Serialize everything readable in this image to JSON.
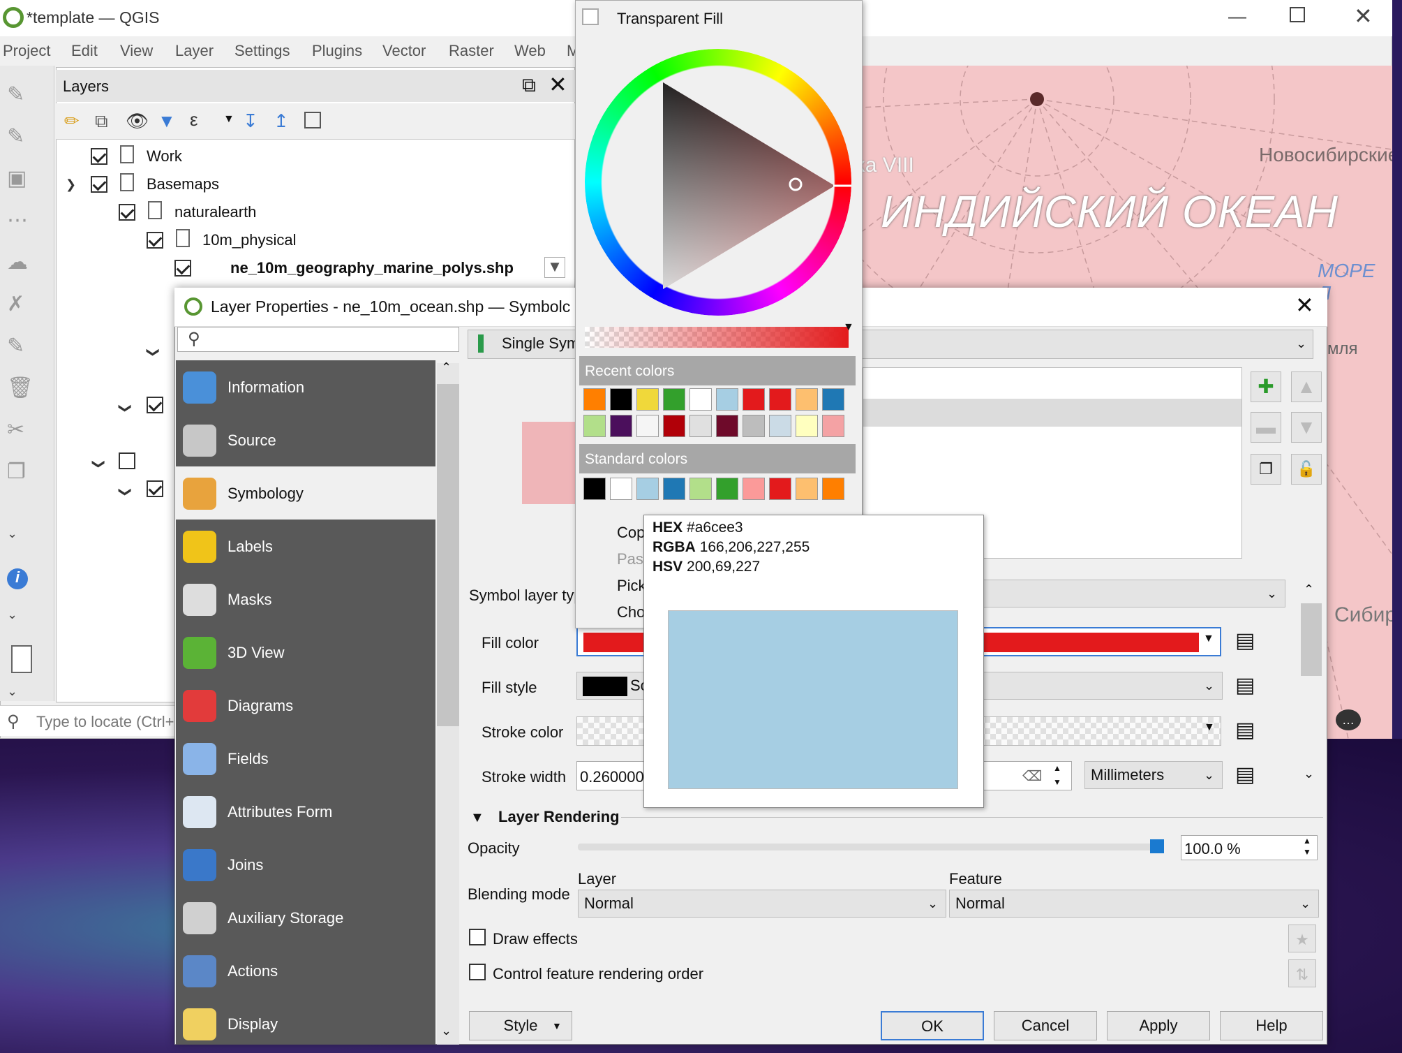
{
  "app": {
    "title": "*template — QGIS",
    "menu": [
      "Project",
      "Edit",
      "View",
      "Layer",
      "Settings",
      "Plugins",
      "Vector",
      "Raster",
      "Web",
      "M"
    ]
  },
  "layers_panel": {
    "title": "Layers",
    "tree": [
      {
        "label": "Work",
        "checked": true
      },
      {
        "label": "Basemaps",
        "checked": true
      },
      {
        "label": "naturalearth",
        "checked": true
      },
      {
        "label": "10m_physical",
        "checked": true
      },
      {
        "label": "ne_10m_geography_marine_polys.shp",
        "checked": true
      }
    ],
    "locator_placeholder": "Type to locate (Ctrl+"
  },
  "map_labels": {
    "ocean": "ИНДИЙСКИЙ ОКЕАН",
    "top_left": "ка VIII",
    "top_right": "Новосибирские",
    "sea": "МОРЕ Л",
    "mid_right": "мля",
    "bottom_right": "Сибир"
  },
  "dialog": {
    "title": "Layer Properties - ne_10m_ocean.shp — Symbolc",
    "renderer": "Single Sym",
    "sidebar": [
      {
        "label": "Information",
        "icon": "information-icon",
        "color": "#4a90d9"
      },
      {
        "label": "Source",
        "icon": "source-icon",
        "color": "#c7c7c7"
      },
      {
        "label": "Symbology",
        "icon": "symbology-icon",
        "color": "#e8a33d"
      },
      {
        "label": "Labels",
        "icon": "labels-icon",
        "color": "#f0c419"
      },
      {
        "label": "Masks",
        "icon": "masks-icon",
        "color": "#dddddd"
      },
      {
        "label": "3D View",
        "icon": "3d-view-icon",
        "color": "#5bb336"
      },
      {
        "label": "Diagrams",
        "icon": "diagrams-icon",
        "color": "#e23b3b"
      },
      {
        "label": "Fields",
        "icon": "fields-icon",
        "color": "#8ab4e8"
      },
      {
        "label": "Attributes Form",
        "icon": "attributes-form-icon",
        "color": "#dde7f2"
      },
      {
        "label": "Joins",
        "icon": "joins-icon",
        "color": "#3a78c9"
      },
      {
        "label": "Auxiliary Storage",
        "icon": "auxiliary-storage-icon",
        "color": "#d0d0d0"
      },
      {
        "label": "Actions",
        "icon": "actions-icon",
        "color": "#5b87c7"
      },
      {
        "label": "Display",
        "icon": "display-icon",
        "color": "#f0d060"
      }
    ],
    "symbol_layer_type_label": "Symbol layer typ",
    "fill_color_label": "Fill color",
    "fill_color": "#e31a1c",
    "fill_style_label": "Fill style",
    "fill_style_value": "Sc",
    "stroke_color_label": "Stroke color",
    "stroke_width_label": "Stroke width",
    "stroke_width_value": "0.260000",
    "unit": "Millimeters",
    "layer_rendering_label": "Layer Rendering",
    "opacity_label": "Opacity",
    "opacity_value": "100.0 %",
    "opacity_fraction": 1.0,
    "blending_mode_label": "Blending mode",
    "layer_label": "Layer",
    "feature_label": "Feature",
    "layer_blend": "Normal",
    "feature_blend": "Normal",
    "draw_effects": "Draw effects",
    "control_order": "Control feature rendering order",
    "buttons": {
      "style": "Style",
      "ok": "OK",
      "cancel": "Cancel",
      "apply": "Apply",
      "help": "Help"
    }
  },
  "color_popup": {
    "transparent_fill": "Transparent Fill",
    "recent_colors_label": "Recent colors",
    "recent_colors": [
      "#ff7f00",
      "#000000",
      "#f0d83a",
      "#33a02c",
      "#ffffff",
      "#a6cee3",
      "#e31a1c",
      "#e31a1c",
      "#fdbf6f",
      "#1f78b4",
      "#b2df8a",
      "#4b0f5c",
      "#f5f5f5",
      "#b10008",
      "#e0e0e0",
      "#6e0a2a",
      "#bdbdbd",
      "#cbdbe6",
      "#ffffbf",
      "#f4a2a4"
    ],
    "standard_colors_label": "Standard colors",
    "standard_colors": [
      "#000000",
      "#ffffff",
      "#a6cee3",
      "#1f78b4",
      "#b2df8a",
      "#33a02c",
      "#fb9a99",
      "#e31a1c",
      "#fdbf6f",
      "#ff7f00"
    ],
    "menu": [
      "Cop",
      "Past",
      "Pick",
      "Cho"
    ]
  },
  "tooltip": {
    "hex_label": "HEX",
    "hex": "#a6cee3",
    "rgba_label": "RGBA",
    "rgba": "166,206,227,255",
    "hsv_label": "HSV",
    "hsv": "200,69,227",
    "swatch_color": "#a6cee3"
  }
}
